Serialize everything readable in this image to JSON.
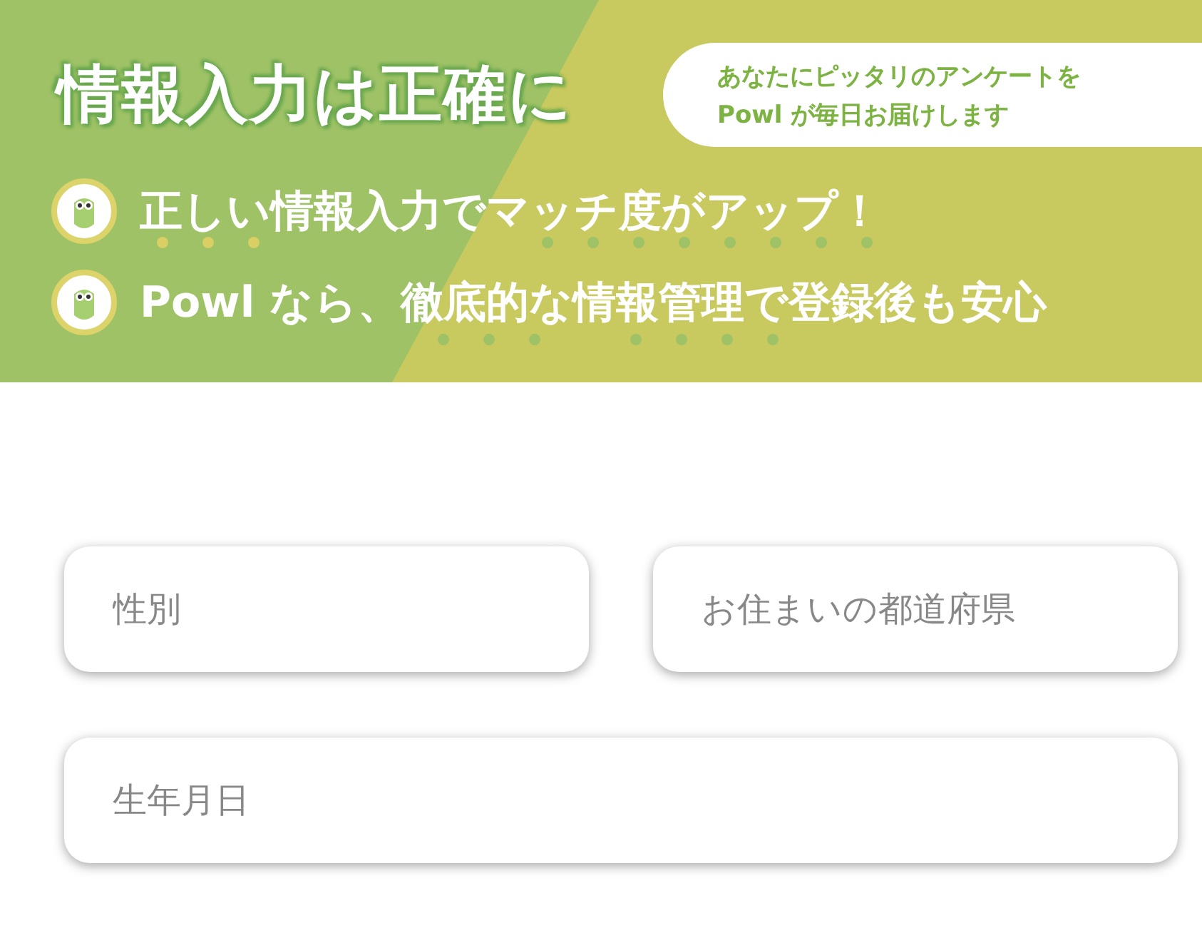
{
  "banner": {
    "title": "情報入力は正確に",
    "bubble": [
      "あなたにピッタリのアンケートを",
      "Powl が毎日お届けします"
    ],
    "points": [
      "正しい情報入力でマッチ度がアップ！",
      "Powl なら、徹底的な情報管理で登録後も安心"
    ]
  },
  "fields": [
    {
      "placeholder": "性別",
      "kind": "half"
    },
    {
      "placeholder": "お住まいの都道府県",
      "kind": "half"
    },
    {
      "placeholder": "生年月日",
      "kind": "full"
    }
  ]
}
